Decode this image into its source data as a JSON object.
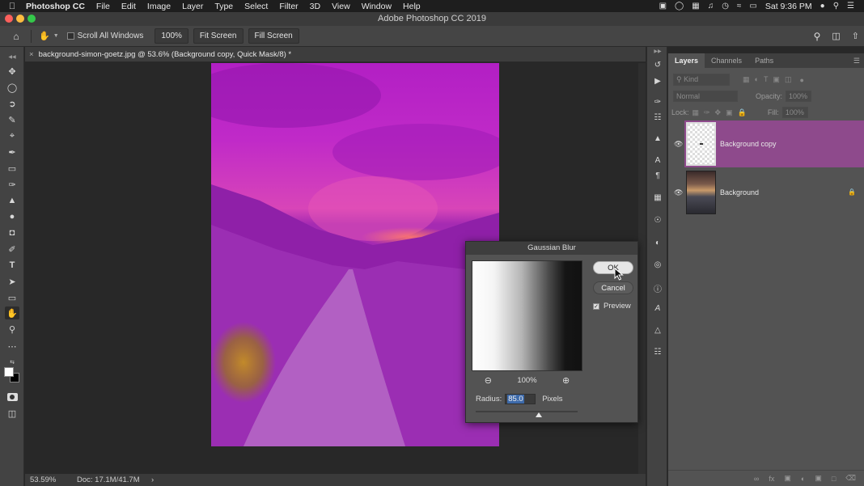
{
  "menubar": {
    "app_name": "Photoshop CC",
    "items": [
      "File",
      "Edit",
      "Image",
      "Layer",
      "Type",
      "Select",
      "Filter",
      "3D",
      "View",
      "Window",
      "Help"
    ],
    "clock": "Sat 9:36 PM"
  },
  "window": {
    "title": "Adobe Photoshop CC 2019"
  },
  "options_bar": {
    "scroll_all_windows_label": "Scroll All Windows",
    "zoom_button": "100%",
    "fit_screen_button": "Fit Screen",
    "fill_screen_button": "Fill Screen"
  },
  "document": {
    "tab_title": "background-simon-goetz.jpg @ 53.6% (Background copy, Quick Mask/8) *"
  },
  "status_bar": {
    "zoom": "53.59%",
    "doc_size": "Doc: 17.1M/41.7M",
    "arrow": "›"
  },
  "layers_panel": {
    "tabs": [
      "Layers",
      "Channels",
      "Paths"
    ],
    "filter_kind": "Kind",
    "blend_mode": "Normal",
    "opacity_label": "Opacity:",
    "opacity_value": "100%",
    "lock_label": "Lock:",
    "fill_label": "Fill:",
    "fill_value": "100%",
    "layers": [
      {
        "name": "Background copy",
        "selected": true
      },
      {
        "name": "Background",
        "locked": true
      }
    ]
  },
  "gaussian_blur": {
    "title": "Gaussian Blur",
    "ok_label": "OK",
    "cancel_label": "Cancel",
    "preview_label": "Preview",
    "preview_checked": true,
    "zoom_value": "100%",
    "radius_label": "Radius:",
    "radius_value": "85.0",
    "radius_unit": "Pixels"
  },
  "colors": {
    "quick_mask_overlay": "#b51bc0",
    "selected_layer": "#8e4a8c",
    "accent_blue": "#3d6aaa"
  }
}
